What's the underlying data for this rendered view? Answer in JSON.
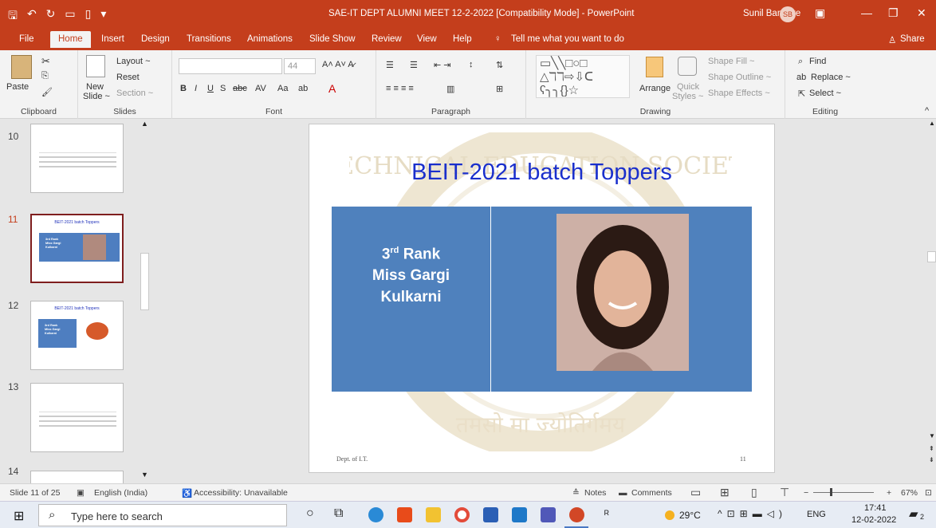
{
  "window": {
    "title": "SAE-IT DEPT ALUMNI MEET 12-2-2022 [Compatibility Mode]  -  PowerPoint",
    "user": "Sunil Bangare",
    "initials": "SB"
  },
  "tabs": [
    "File",
    "Home",
    "Insert",
    "Design",
    "Transitions",
    "Animations",
    "Slide Show",
    "Review",
    "View",
    "Help"
  ],
  "tell_me": "Tell me what you want to do",
  "share": "Share",
  "ribbon": {
    "clipboard": {
      "paste": "Paste",
      "name": "Clipboard"
    },
    "slides": {
      "new": "New",
      "slide": "Slide ~",
      "layout": "Layout ~",
      "reset": "Reset",
      "section": "Section ~",
      "name": "Slides"
    },
    "font": {
      "size": "44",
      "name": "Font"
    },
    "paragraph": {
      "name": "Paragraph"
    },
    "drawing": {
      "arrange": "Arrange",
      "quick1": "Quick",
      "quick2": "Styles ~",
      "fill": "Shape Fill ~",
      "outline": "Shape Outline ~",
      "effects": "Shape Effects ~",
      "name": "Drawing"
    },
    "editing": {
      "find": "Find",
      "replace": "Replace ~",
      "select": "Select ~",
      "name": "Editing"
    }
  },
  "thumbs": [
    {
      "num": "10"
    },
    {
      "num": "11",
      "title": "BEIT-2021 batch Toppers",
      "l1": "3rd Rank",
      "l2": "Miss Gargi",
      "l3": "Kulkarni"
    },
    {
      "num": "12",
      "title": "BEIT-2021 batch Toppers",
      "l1": "3rd Rank",
      "l2": "Miss Gargi",
      "l3": "Kulkarni"
    },
    {
      "num": "13"
    },
    {
      "num": "14"
    }
  ],
  "slide": {
    "title": "BEIT-2021 batch Toppers",
    "rank": "3",
    "rank_sup": "rd",
    "rank_word": "Rank",
    "name1": "Miss Gargi",
    "name2": "Kulkarni",
    "footer": "Dept. of I.T.",
    "page": "11",
    "wm_top": "TECHNICAL EDUCATION SOCIETY",
    "wm_bottom": "तमसो मा ज्योतिर्गमय"
  },
  "status": {
    "slide": "Slide 11 of 25",
    "lang": "English (India)",
    "access": "Accessibility: Unavailable",
    "notes": "Notes",
    "comments": "Comments",
    "zoom": "67%"
  },
  "taskbar": {
    "search": "Type here to search",
    "temp": "29°C",
    "lang": "ENG",
    "time": "17:41",
    "date": "12-02-2022",
    "notif": "2"
  }
}
